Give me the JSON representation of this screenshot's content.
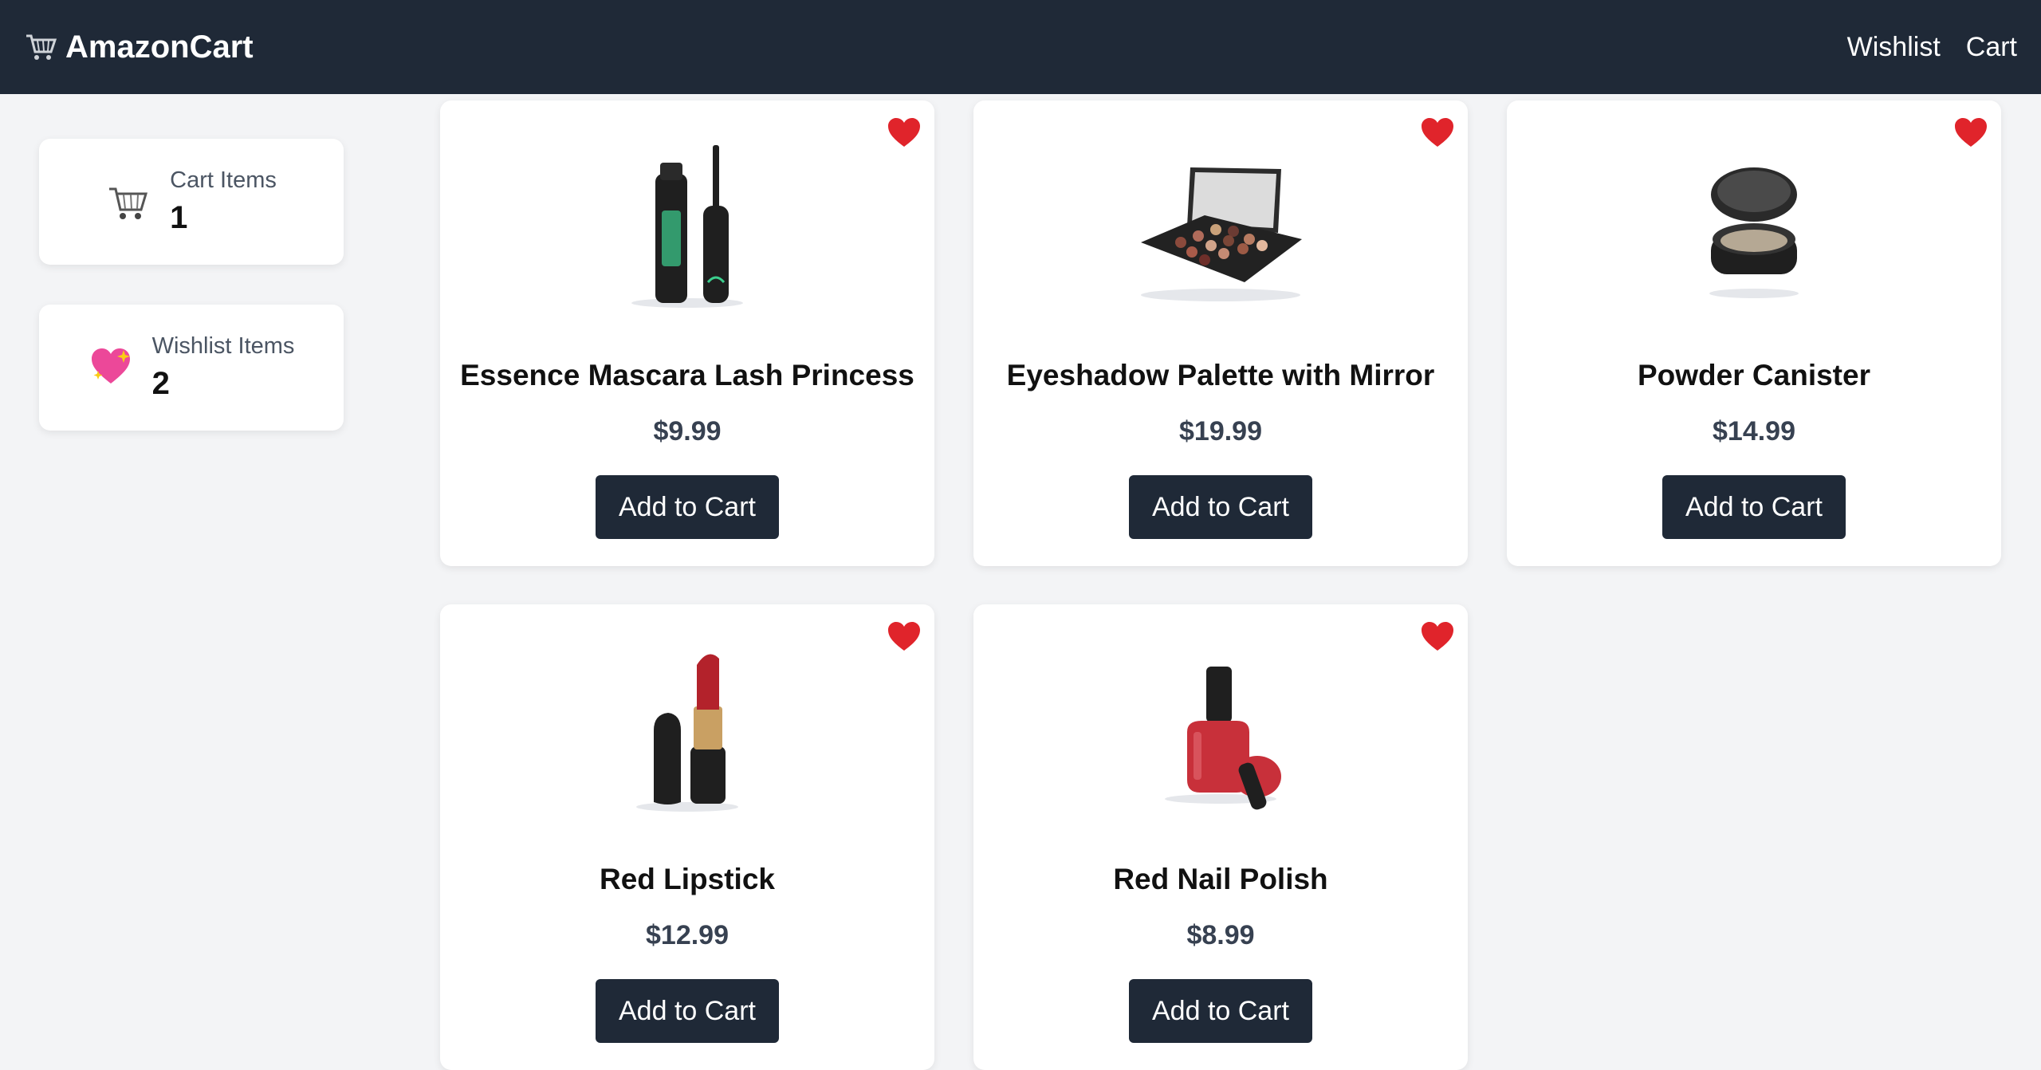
{
  "header": {
    "brand": "AmazonCart",
    "nav": [
      "Wishlist",
      "Cart"
    ]
  },
  "stats": [
    {
      "label": "Cart Items",
      "value": "1",
      "icon": "cart-icon"
    },
    {
      "label": "Wishlist Items",
      "value": "2",
      "icon": "sparkling-heart-icon"
    }
  ],
  "products": [
    {
      "name": "Essence Mascara Lash Princess",
      "price": "$9.99",
      "button": "Add to Cart",
      "icon": "mascara-image"
    },
    {
      "name": "Eyeshadow Palette with Mirror",
      "price": "$19.99",
      "button": "Add to Cart",
      "icon": "eyeshadow-palette-image"
    },
    {
      "name": "Powder Canister",
      "price": "$14.99",
      "button": "Add to Cart",
      "icon": "powder-canister-image"
    },
    {
      "name": "Red Lipstick",
      "price": "$12.99",
      "button": "Add to Cart",
      "icon": "lipstick-image"
    },
    {
      "name": "Red Nail Polish",
      "price": "$8.99",
      "button": "Add to Cart",
      "icon": "nail-polish-image"
    }
  ],
  "colors": {
    "header_bg": "#1f2937",
    "page_bg": "#f3f4f6",
    "button_bg": "#1f2937",
    "heart": "#e0242b"
  }
}
